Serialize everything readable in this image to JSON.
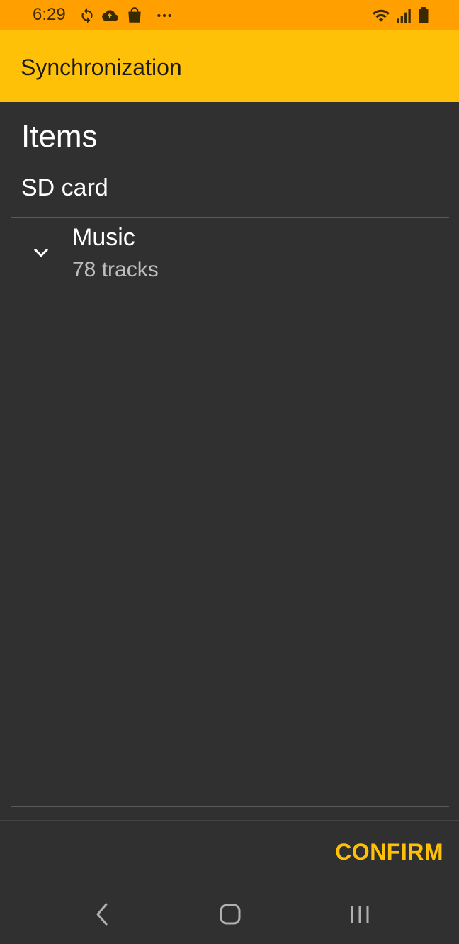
{
  "status_bar": {
    "time": "6:29",
    "icons": [
      "sync-icon",
      "cloud-icon",
      "shopping-bag-icon",
      "more-dots-icon",
      "wifi-icon",
      "signal-icon",
      "battery-icon"
    ],
    "background_color": "#ffa000"
  },
  "app_bar": {
    "title": "Synchronization",
    "background_color": "#ffc107"
  },
  "content": {
    "section_title": "Items",
    "storage_label": "SD card",
    "items": [
      {
        "name": "Music",
        "subtitle": "78 tracks",
        "icon": "chevron-down-icon"
      }
    ]
  },
  "actions": {
    "confirm_label": "CONFIRM",
    "accent_color": "#ffc107"
  },
  "nav_bar": {
    "buttons": [
      "back-icon",
      "home-icon",
      "recent-apps-icon"
    ]
  }
}
